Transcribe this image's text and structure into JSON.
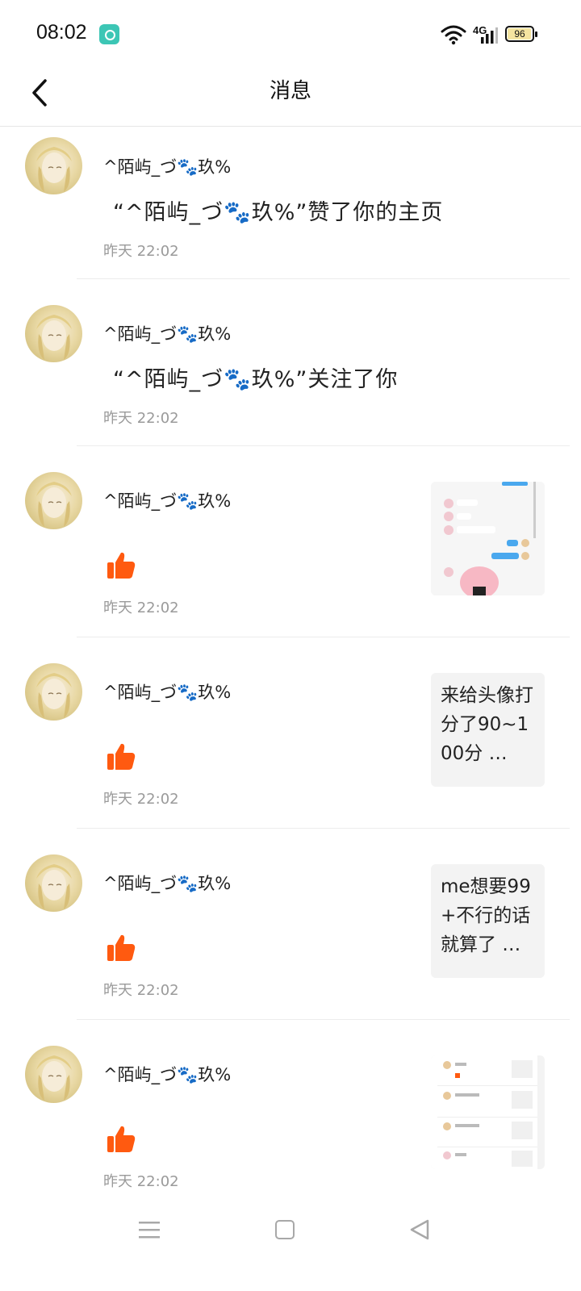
{
  "status_bar": {
    "time": "08:02",
    "network": "4G",
    "battery": "96",
    "battery_level": 0.96
  },
  "header": {
    "title": "消息",
    "back_icon": "chevron-left-icon"
  },
  "messages": [
    {
      "user": "^陌屿_づ🐾玖%",
      "text": "“^陌屿_づ🐾玖%”赞了你的主页",
      "time": "昨天 22:02"
    },
    {
      "user": "^陌屿_づ🐾玖%",
      "text": "“^陌屿_づ🐾玖%”关注了你",
      "time": "昨天 22:02"
    },
    {
      "user": "^陌屿_づ🐾玖%",
      "icon": "thumbs-up-icon",
      "time": "昨天 22:02",
      "thumb": "chat-screenshot"
    },
    {
      "user": "^陌屿_づ🐾玖%",
      "icon": "thumbs-up-icon",
      "time": "昨天 22:02",
      "thumb_text": "来给头像打分了90~100分 …"
    },
    {
      "user": "^陌屿_づ🐾玖%",
      "icon": "thumbs-up-icon",
      "time": "昨天 22:02",
      "thumb_text": "me想要99+不行的话就算了 …"
    },
    {
      "user": "^陌屿_づ🐾玖%",
      "icon": "thumbs-up-icon",
      "time": "昨天 22:02",
      "thumb": "messages-screenshot"
    }
  ],
  "colors": {
    "like": "#ff5a10",
    "time": "#9a9a9a",
    "divider": "#ececec"
  },
  "nav_bar": {
    "menu_icon": "menu-icon",
    "home_icon": "square-home-icon",
    "back_icon": "triangle-back-icon"
  }
}
